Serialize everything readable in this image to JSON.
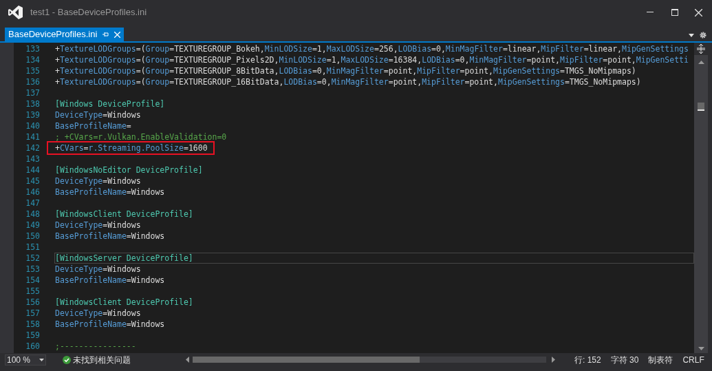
{
  "window": {
    "title": "test1 - BaseDeviceProfiles.ini"
  },
  "tabs": [
    {
      "label": "BaseDeviceProfiles.ini",
      "selected": true
    }
  ],
  "editor": {
    "lines": [
      {
        "number": "133",
        "current": false,
        "boxed": false,
        "segments": [
          {
            "text": "+",
            "kind": "text"
          },
          {
            "text": "TextureLODGroups",
            "kind": "key"
          },
          {
            "text": "=(",
            "kind": "text"
          },
          {
            "text": "Group",
            "kind": "key"
          },
          {
            "text": "=TEXTUREGROUP_Bokeh,",
            "kind": "text"
          },
          {
            "text": "MinLODSize",
            "kind": "key"
          },
          {
            "text": "=1,",
            "kind": "text"
          },
          {
            "text": "MaxLODSize",
            "kind": "key"
          },
          {
            "text": "=256,",
            "kind": "text"
          },
          {
            "text": "LODBias",
            "kind": "key"
          },
          {
            "text": "=0,",
            "kind": "text"
          },
          {
            "text": "MinMagFilter",
            "kind": "key"
          },
          {
            "text": "=linear,",
            "kind": "text"
          },
          {
            "text": "MipFilter",
            "kind": "key"
          },
          {
            "text": "=linear,",
            "kind": "text"
          },
          {
            "text": "MipGenSettings",
            "kind": "key"
          }
        ]
      },
      {
        "number": "134",
        "current": false,
        "boxed": false,
        "segments": [
          {
            "text": "+",
            "kind": "text"
          },
          {
            "text": "TextureLODGroups",
            "kind": "key"
          },
          {
            "text": "=(",
            "kind": "text"
          },
          {
            "text": "Group",
            "kind": "key"
          },
          {
            "text": "=TEXTUREGROUP_Pixels2D,",
            "kind": "text"
          },
          {
            "text": "MinLODSize",
            "kind": "key"
          },
          {
            "text": "=1,",
            "kind": "text"
          },
          {
            "text": "MaxLODSize",
            "kind": "key"
          },
          {
            "text": "=16384,",
            "kind": "text"
          },
          {
            "text": "LODBias",
            "kind": "key"
          },
          {
            "text": "=0,",
            "kind": "text"
          },
          {
            "text": "MinMagFilter",
            "kind": "key"
          },
          {
            "text": "=point,",
            "kind": "text"
          },
          {
            "text": "MipFilter",
            "kind": "key"
          },
          {
            "text": "=point,",
            "kind": "text"
          },
          {
            "text": "MipGenSetti",
            "kind": "key"
          }
        ]
      },
      {
        "number": "135",
        "current": false,
        "boxed": false,
        "segments": [
          {
            "text": "+",
            "kind": "text"
          },
          {
            "text": "TextureLODGroups",
            "kind": "key"
          },
          {
            "text": "=(",
            "kind": "text"
          },
          {
            "text": "Group",
            "kind": "key"
          },
          {
            "text": "=TEXTUREGROUP_8BitData,",
            "kind": "text"
          },
          {
            "text": "LODBias",
            "kind": "key"
          },
          {
            "text": "=0,",
            "kind": "text"
          },
          {
            "text": "MinMagFilter",
            "kind": "key"
          },
          {
            "text": "=point,",
            "kind": "text"
          },
          {
            "text": "MipFilter",
            "kind": "key"
          },
          {
            "text": "=point,",
            "kind": "text"
          },
          {
            "text": "MipGenSettings",
            "kind": "key"
          },
          {
            "text": "=TMGS_NoMipmaps)",
            "kind": "text"
          }
        ]
      },
      {
        "number": "136",
        "current": false,
        "boxed": false,
        "segments": [
          {
            "text": "+",
            "kind": "text"
          },
          {
            "text": "TextureLODGroups",
            "kind": "key"
          },
          {
            "text": "=(",
            "kind": "text"
          },
          {
            "text": "Group",
            "kind": "key"
          },
          {
            "text": "=TEXTUREGROUP_16BitData,",
            "kind": "text"
          },
          {
            "text": "LODBias",
            "kind": "key"
          },
          {
            "text": "=0,",
            "kind": "text"
          },
          {
            "text": "MinMagFilter",
            "kind": "key"
          },
          {
            "text": "=point,",
            "kind": "text"
          },
          {
            "text": "MipFilter",
            "kind": "key"
          },
          {
            "text": "=point,",
            "kind": "text"
          },
          {
            "text": "MipGenSettings",
            "kind": "key"
          },
          {
            "text": "=TMGS_NoMipmaps)",
            "kind": "text"
          }
        ]
      },
      {
        "number": "137",
        "current": false,
        "boxed": false
      },
      {
        "number": "138",
        "current": false,
        "boxed": false,
        "segments": [
          {
            "text": "[Windows DeviceProfile]",
            "kind": "section"
          }
        ]
      },
      {
        "number": "139",
        "current": false,
        "boxed": false,
        "segments": [
          {
            "text": "DeviceType",
            "kind": "key"
          },
          {
            "text": "=Windows",
            "kind": "text"
          }
        ]
      },
      {
        "number": "140",
        "current": false,
        "boxed": false,
        "segments": [
          {
            "text": "BaseProfileName",
            "kind": "key"
          },
          {
            "text": "=",
            "kind": "text"
          }
        ]
      },
      {
        "number": "141",
        "current": false,
        "boxed": false,
        "segments": [
          {
            "text": "; +CVars=r.Vulkan.EnableValidation=0",
            "kind": "comment"
          }
        ]
      },
      {
        "number": "142",
        "current": false,
        "boxed": true,
        "segments": [
          {
            "text": "+",
            "kind": "text"
          },
          {
            "text": "CVars",
            "kind": "key"
          },
          {
            "text": "=",
            "kind": "text"
          },
          {
            "text": "r.Streaming.PoolSize",
            "kind": "key"
          },
          {
            "text": "=1600",
            "kind": "text"
          }
        ]
      },
      {
        "number": "143",
        "current": false,
        "boxed": false
      },
      {
        "number": "144",
        "current": false,
        "boxed": false,
        "segments": [
          {
            "text": "[WindowsNoEditor DeviceProfile]",
            "kind": "section"
          }
        ]
      },
      {
        "number": "145",
        "current": false,
        "boxed": false,
        "segments": [
          {
            "text": "DeviceType",
            "kind": "key"
          },
          {
            "text": "=Windows",
            "kind": "text"
          }
        ]
      },
      {
        "number": "146",
        "current": false,
        "boxed": false,
        "segments": [
          {
            "text": "BaseProfileName",
            "kind": "key"
          },
          {
            "text": "=Windows",
            "kind": "text"
          }
        ]
      },
      {
        "number": "147",
        "current": false,
        "boxed": false
      },
      {
        "number": "148",
        "current": false,
        "boxed": false,
        "segments": [
          {
            "text": "[WindowsClient DeviceProfile]",
            "kind": "section"
          }
        ]
      },
      {
        "number": "149",
        "current": false,
        "boxed": false,
        "segments": [
          {
            "text": "DeviceType",
            "kind": "key"
          },
          {
            "text": "=Windows",
            "kind": "text"
          }
        ]
      },
      {
        "number": "150",
        "current": false,
        "boxed": false,
        "segments": [
          {
            "text": "BaseProfileName",
            "kind": "key"
          },
          {
            "text": "=Windows",
            "kind": "text"
          }
        ]
      },
      {
        "number": "151",
        "current": false,
        "boxed": false
      },
      {
        "number": "152",
        "current": true,
        "boxed": false,
        "segments": [
          {
            "text": "[WindowsServer DeviceProfile]",
            "kind": "section"
          }
        ]
      },
      {
        "number": "153",
        "current": false,
        "boxed": false,
        "segments": [
          {
            "text": "DeviceType",
            "kind": "key"
          },
          {
            "text": "=Windows",
            "kind": "text"
          }
        ]
      },
      {
        "number": "154",
        "current": false,
        "boxed": false,
        "segments": [
          {
            "text": "BaseProfileName",
            "kind": "key"
          },
          {
            "text": "=Windows",
            "kind": "text"
          }
        ]
      },
      {
        "number": "155",
        "current": false,
        "boxed": false
      },
      {
        "number": "156",
        "current": false,
        "boxed": false,
        "segments": [
          {
            "text": "[WindowsClient DeviceProfile]",
            "kind": "section"
          }
        ]
      },
      {
        "number": "157",
        "current": false,
        "boxed": false,
        "segments": [
          {
            "text": "DeviceType",
            "kind": "key"
          },
          {
            "text": "=Windows",
            "kind": "text"
          }
        ]
      },
      {
        "number": "158",
        "current": false,
        "boxed": false,
        "segments": [
          {
            "text": "BaseProfileName",
            "kind": "key"
          },
          {
            "text": "=Windows",
            "kind": "text"
          }
        ]
      },
      {
        "number": "159",
        "current": false,
        "boxed": false
      },
      {
        "number": "160",
        "current": false,
        "boxed": false,
        "segments": [
          {
            "text": ";----------------",
            "kind": "comment"
          }
        ]
      }
    ]
  },
  "status_bar": {
    "zoom": "100 %",
    "issues": "未找到相关问题",
    "line": "行: 152",
    "char": "字符 30",
    "indent": "制表符",
    "eol": "CRLF"
  }
}
